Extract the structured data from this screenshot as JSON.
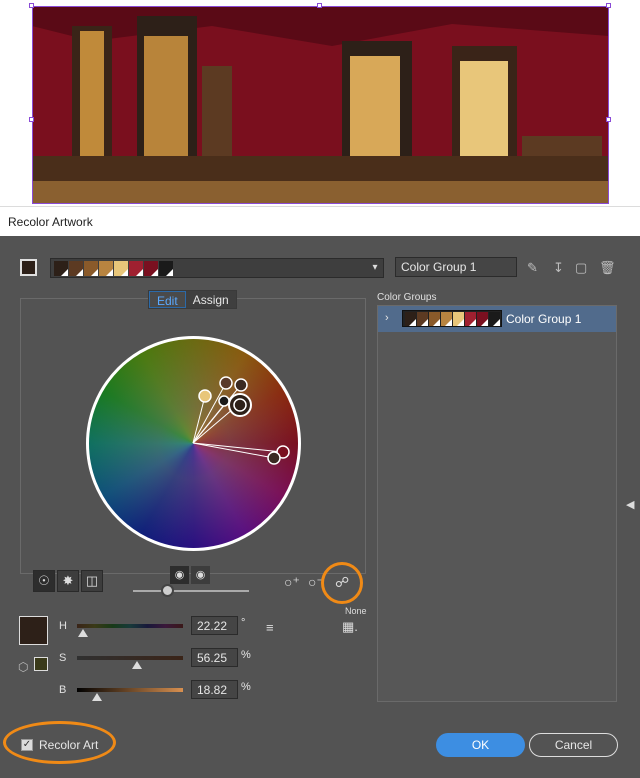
{
  "window": {
    "title": "Recolor Artwork"
  },
  "artwork": {
    "description_colors": [
      "#7a0f1e",
      "#2d2018",
      "#c08a3a",
      "#e8c67a",
      "#5c3a22"
    ]
  },
  "toolbar": {
    "current_color": "#2d2018",
    "group_colors": [
      "#2d2018",
      "#5c3a22",
      "#8a5a2a",
      "#b88440",
      "#e8c67a",
      "#a02030",
      "#7a1020",
      "#1a1a1a"
    ],
    "group_name_value": "Color Group 1",
    "icons": [
      "eyedropper-icon",
      "save-icon",
      "folder-icon",
      "trash-icon"
    ]
  },
  "editor": {
    "tabs": {
      "edit": "Edit",
      "assign": "Assign"
    },
    "mode_icons": [
      "smooth-wheel-icon",
      "segmented-wheel-icon",
      "color-bars-icon"
    ],
    "display_icons": [
      "brightness-icon",
      "saturation-icon"
    ],
    "none_label": "None"
  },
  "hsb": {
    "h_label": "H",
    "h_value": "22.22",
    "h_unit": "°",
    "s_label": "S",
    "s_value": "56.25",
    "s_unit": "%",
    "b_label": "B",
    "b_value": "18.82",
    "b_unit": "%",
    "h_fraction": 0.062,
    "s_fraction": 0.5625,
    "b_fraction": 0.188
  },
  "color_groups": {
    "label": "Color Groups",
    "items": [
      {
        "name": "Color Group 1",
        "colors": [
          "#2d2018",
          "#5c3a22",
          "#8a5a2a",
          "#b88440",
          "#e8c67a",
          "#a02030",
          "#7a1020",
          "#1a1a1a"
        ]
      }
    ]
  },
  "footer": {
    "recolor_art_label": "Recolor Art",
    "recolor_art_checked": true,
    "ok_label": "OK",
    "cancel_label": "Cancel"
  }
}
